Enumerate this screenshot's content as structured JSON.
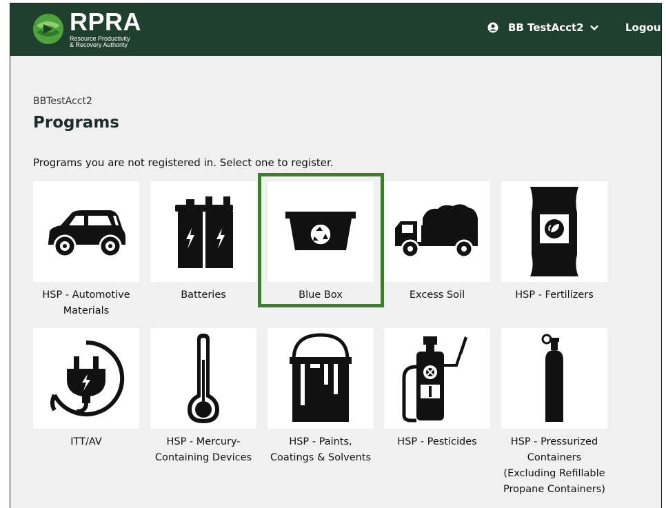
{
  "header": {
    "brand": "RPRA",
    "brand_sub_line1": "Resource Productivity",
    "brand_sub_line2": "& Recovery Authority",
    "user_name": "BB TestAcct2",
    "logout_label": "Logout"
  },
  "page": {
    "breadcrumb": "BBTestAcct2",
    "title": "Programs",
    "subtitle": "Programs you are not registered in. Select one to register."
  },
  "programs": [
    {
      "label": "HSP - Automotive Materials",
      "icon": "car-icon"
    },
    {
      "label": "Batteries",
      "icon": "battery-icon"
    },
    {
      "label": "Blue Box",
      "icon": "blue-box-icon"
    },
    {
      "label": "Excess Soil",
      "icon": "dump-truck-icon"
    },
    {
      "label": "HSP - Fertilizers",
      "icon": "fertilizer-bag-icon"
    },
    {
      "label": "ITT/AV",
      "icon": "plug-icon"
    },
    {
      "label": "HSP - Mercury-Containing Devices",
      "icon": "thermometer-icon"
    },
    {
      "label": "HSP - Paints, Coatings & Solvents",
      "icon": "paint-can-icon"
    },
    {
      "label": "HSP - Pesticides",
      "icon": "sprayer-icon"
    },
    {
      "label": "HSP - Pressurized Containers (Excluding Refillable Propane Containers)",
      "icon": "gas-cylinder-icon"
    }
  ],
  "colors": {
    "header_bg": "#20402f",
    "page_bg": "#eff0ef",
    "highlight": "#3c7e2c"
  }
}
